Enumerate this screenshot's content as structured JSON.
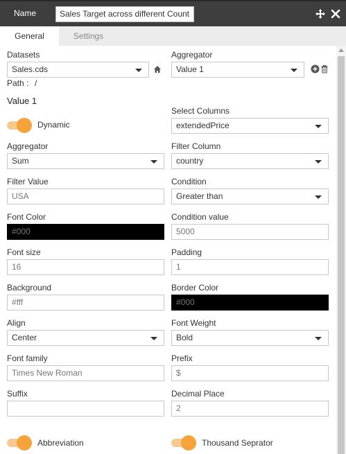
{
  "titlebar": {
    "name_label": "Name",
    "name_value": "Sales Target across different Count",
    "move_icon": "move-arrows-icon",
    "close_icon": "close-x-icon"
  },
  "tabs": {
    "general": "General",
    "settings": "Settings",
    "active": "General"
  },
  "datasets": {
    "label": "Datasets",
    "value": "Sales.cds",
    "home_icon": "home-icon"
  },
  "aggregator_top": {
    "label": "Aggregator",
    "value": "Value 1",
    "add_icon": "plus-circle-icon",
    "delete_icon": "trash-icon"
  },
  "path": {
    "label": "Path :",
    "value": "/"
  },
  "value_section": {
    "title": "Value 1"
  },
  "dynamic": {
    "label": "Dynamic",
    "enabled": true
  },
  "select_columns": {
    "label": "Select Columns",
    "value": "extendedPrice"
  },
  "aggregator": {
    "label": "Aggregator",
    "value": "Sum"
  },
  "filter_column": {
    "label": "Filter Column",
    "value": "country"
  },
  "filter_value": {
    "label": "Filter Value",
    "value": "USA"
  },
  "condition": {
    "label": "Condition",
    "value": "Greater than"
  },
  "font_color": {
    "label": "Font Color",
    "value": "#000"
  },
  "condition_value": {
    "label": "Condition value",
    "value": "5000"
  },
  "font_size": {
    "label": "Font size",
    "value": "16"
  },
  "padding": {
    "label": "Padding",
    "value": "1"
  },
  "background": {
    "label": "Background",
    "value": "#fff"
  },
  "border_color": {
    "label": "Border Color",
    "value": "#000"
  },
  "align": {
    "label": "Align",
    "value": "Center"
  },
  "font_weight": {
    "label": "Font Weight",
    "value": "Bold"
  },
  "font_family": {
    "label": "Font family",
    "value": "Times New Roman"
  },
  "prefix": {
    "label": "Prefix",
    "value": "$"
  },
  "suffix": {
    "label": "Suffix",
    "value": ""
  },
  "decimal_place": {
    "label": "Decimal Place",
    "value": "2"
  },
  "abbreviation": {
    "label": "Abbreviation",
    "enabled": true
  },
  "thousand_separator": {
    "label": "Thousand Seprator",
    "enabled": true
  },
  "colors": {
    "toggle_on": "#f5a33a",
    "toggle_track": "#f8c98e",
    "titlebar": "#3e3e3e"
  }
}
